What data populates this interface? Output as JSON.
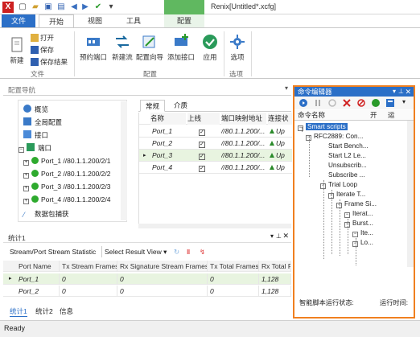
{
  "titlebar": {
    "app_logo": "X",
    "title": "Renix[Untitled*.xcfg]",
    "context_tab_header": ""
  },
  "ribbon_tabs": [
    "文件",
    "开始",
    "视图",
    "工具",
    "配置"
  ],
  "ribbon": {
    "new_label": "新建",
    "open_label": "打开",
    "save_label": "保存",
    "save_result_label": "保存结果",
    "file_group": "文件",
    "reserve_port_label": "预约端口",
    "new_stream_label": "新建流",
    "config_wizard_label": "配置向导",
    "add_port_label": "添加接口",
    "apply_label": "应用",
    "config_group": "配置",
    "options_label": "选项",
    "options_group": "选项"
  },
  "nav": {
    "title": "配置导航",
    "items": [
      {
        "label": "概览",
        "icon": "info-icon"
      },
      {
        "label": "全局配置",
        "icon": "gear-icon"
      },
      {
        "label": "接口",
        "icon": "interface-icon"
      },
      {
        "label": "端口",
        "icon": "port-icon"
      },
      {
        "label": "Port_1 //80.1.1.200/2/1",
        "icon": "green-dot-icon"
      },
      {
        "label": "Port_2 //80.1.1.200/2/2",
        "icon": "green-dot-icon"
      },
      {
        "label": "Port_3 //80.1.1.200/2/3",
        "icon": "green-dot-icon"
      },
      {
        "label": "Port_4 //80.1.1.200/2/4",
        "icon": "green-dot-icon"
      },
      {
        "label": "数据包捕获",
        "icon": "capture-icon"
      }
    ]
  },
  "port_view": {
    "tabs": [
      "常规",
      "介质"
    ],
    "columns": [
      "名称",
      "上线",
      "端口映射地址",
      "连接状"
    ],
    "rows": [
      {
        "name": "Port_1",
        "online": "✓",
        "addr": "//80.1.1.200/...",
        "status": "Up"
      },
      {
        "name": "Port_2",
        "online": "✓",
        "addr": "//80.1.1.200/...",
        "status": "Up"
      },
      {
        "name": "Port_3",
        "online": "✓",
        "addr": "//80.1.1.200/...",
        "status": "Up"
      },
      {
        "name": "Port_4",
        "online": "✓",
        "addr": "//80.1.1.200/...",
        "status": "Up"
      }
    ]
  },
  "stats": {
    "title": "统计1",
    "view_label": "Stream/Port Stream Statistic",
    "select_view_label": "Select Result View",
    "columns": [
      "Port Name",
      "Tx Stream Frames",
      "Rx Signature Stream Frames",
      "Tx Total Frames",
      "Rx Total F"
    ],
    "rows": [
      {
        "port": "Port_1",
        "tx_stream": "0",
        "rx_sig": "0",
        "tx_total": "0",
        "rx_total": "1,128"
      },
      {
        "port": "Port_2",
        "tx_stream": "0",
        "rx_sig": "0",
        "tx_total": "0",
        "rx_total": "1,128"
      }
    ],
    "tabs": [
      "统计1",
      "统计2",
      "信息"
    ]
  },
  "cmd_editor": {
    "title": "命令编辑器",
    "columns": [
      "命令名称",
      "开",
      "运"
    ],
    "items": [
      "Smart scripts",
      "RFC2889: Con...",
      "Start Bench...",
      "Start L2 Le...",
      "Unsubscrib...",
      "Subscribe ...",
      "Trial Loop",
      "Iterate T...",
      "Frame Si...",
      "Iterat...",
      "Burst...",
      "Ite...",
      "Lo..."
    ],
    "status_label": "智能脚本运行状态:",
    "run_time_label": "运行时间:"
  },
  "statusbar": {
    "text": "Ready"
  }
}
